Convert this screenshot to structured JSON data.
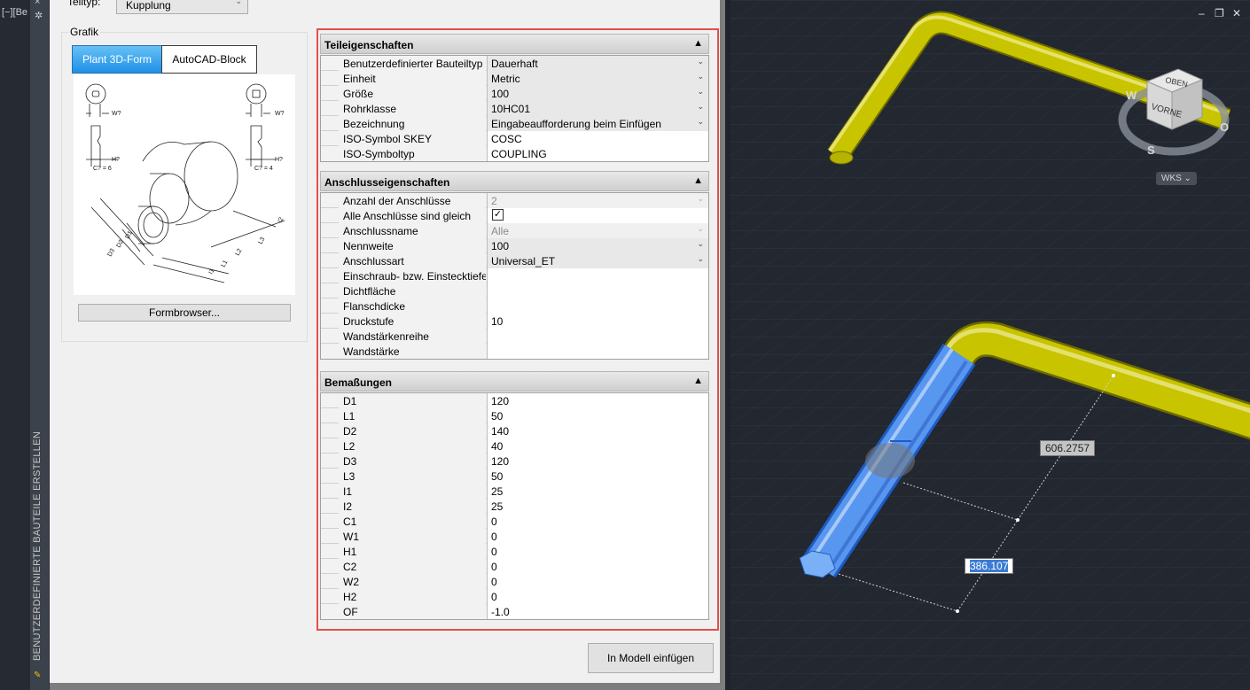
{
  "viewport_label": "[−][Be",
  "palette": {
    "title": "BENUTZERDEFINIERTE BAUTEILE ERSTELLEN",
    "close_glyph": "×",
    "gear_icon": "gear-icon"
  },
  "teiltyp": {
    "label": "Teiltyp:",
    "value": "Kupplung"
  },
  "grafik": {
    "label": "Grafik",
    "tabs": [
      "Plant 3D-Form",
      "AutoCAD-Block"
    ],
    "active_tab": "Plant 3D-Form",
    "sketch_labels": [
      "W?",
      "H?",
      "C? = 6",
      "W?",
      "H?",
      "C? = 4",
      "D1",
      "D2",
      "D3",
      "L1",
      "L2",
      "L3",
      "I1",
      "I2"
    ],
    "formbrowser_label": "Formbrowser..."
  },
  "teileigenschaften": {
    "title": "Teileigenschaften",
    "rows": [
      {
        "name": "Benutzerdefinierter Bauteiltyp",
        "value": "Dauerhaft",
        "kind": "dropdown"
      },
      {
        "name": "Einheit",
        "value": "Metric",
        "kind": "dropdown"
      },
      {
        "name": "Größe",
        "value": "100",
        "kind": "dropdown"
      },
      {
        "name": "Rohrklasse",
        "value": "10HC01",
        "kind": "dropdown"
      },
      {
        "name": "Bezeichnung",
        "value": "Eingabeaufforderung beim Einfügen",
        "kind": "dropdown"
      },
      {
        "name": "ISO-Symbol SKEY",
        "value": "COSC",
        "kind": "text"
      },
      {
        "name": "ISO-Symboltyp",
        "value": "COUPLING",
        "kind": "text"
      }
    ]
  },
  "anschlusseigenschaften": {
    "title": "Anschlusseigenschaften",
    "rows": [
      {
        "name": "Anzahl der Anschlüsse",
        "value": "2",
        "kind": "dropdown-disabled"
      },
      {
        "name": "Alle Anschlüsse sind gleich",
        "value": "",
        "kind": "checkbox",
        "checked": true
      },
      {
        "name": "Anschlussname",
        "value": "Alle",
        "kind": "dropdown-disabled"
      },
      {
        "name": "Nennweite",
        "value": "100",
        "kind": "dropdown"
      },
      {
        "name": "Anschlussart",
        "value": "Universal_ET",
        "kind": "dropdown"
      },
      {
        "name": "Einschraub- bzw. Einstecktiefe",
        "value": "",
        "kind": "text"
      },
      {
        "name": "Dichtfläche",
        "value": "",
        "kind": "text"
      },
      {
        "name": "Flanschdicke",
        "value": "",
        "kind": "text"
      },
      {
        "name": "Druckstufe",
        "value": "10",
        "kind": "text"
      },
      {
        "name": "Wandstärkenreihe",
        "value": "",
        "kind": "text"
      },
      {
        "name": "Wandstärke",
        "value": "",
        "kind": "text"
      }
    ]
  },
  "bemassungen": {
    "title": "Bemaßungen",
    "rows": [
      {
        "name": "D1",
        "value": "120"
      },
      {
        "name": "L1",
        "value": "50"
      },
      {
        "name": "D2",
        "value": "140"
      },
      {
        "name": "L2",
        "value": "40"
      },
      {
        "name": "D3",
        "value": "120"
      },
      {
        "name": "L3",
        "value": "50"
      },
      {
        "name": "I1",
        "value": "25"
      },
      {
        "name": "I2",
        "value": "25"
      },
      {
        "name": "C1",
        "value": "0"
      },
      {
        "name": "W1",
        "value": "0"
      },
      {
        "name": "H1",
        "value": "0"
      },
      {
        "name": "C2",
        "value": "0"
      },
      {
        "name": "W2",
        "value": "0"
      },
      {
        "name": "H2",
        "value": "0"
      },
      {
        "name": "OF",
        "value": "-1.0"
      }
    ]
  },
  "insert_button": "In Modell einfügen",
  "viewcube": {
    "top": "OBEN",
    "front": "VORNE",
    "west": "W",
    "south": "S",
    "east": "O",
    "wcs": "WKS"
  },
  "window_controls": {
    "minimize": "–",
    "restore": "❐",
    "close": "✕"
  },
  "dimensions": {
    "a": "606.2757",
    "b": "386.107"
  },
  "colors": {
    "pipe": "#c8c400",
    "selected": "#4a8ff0",
    "accent_frame": "#e0504a",
    "tab_active": "#1e90e8"
  }
}
